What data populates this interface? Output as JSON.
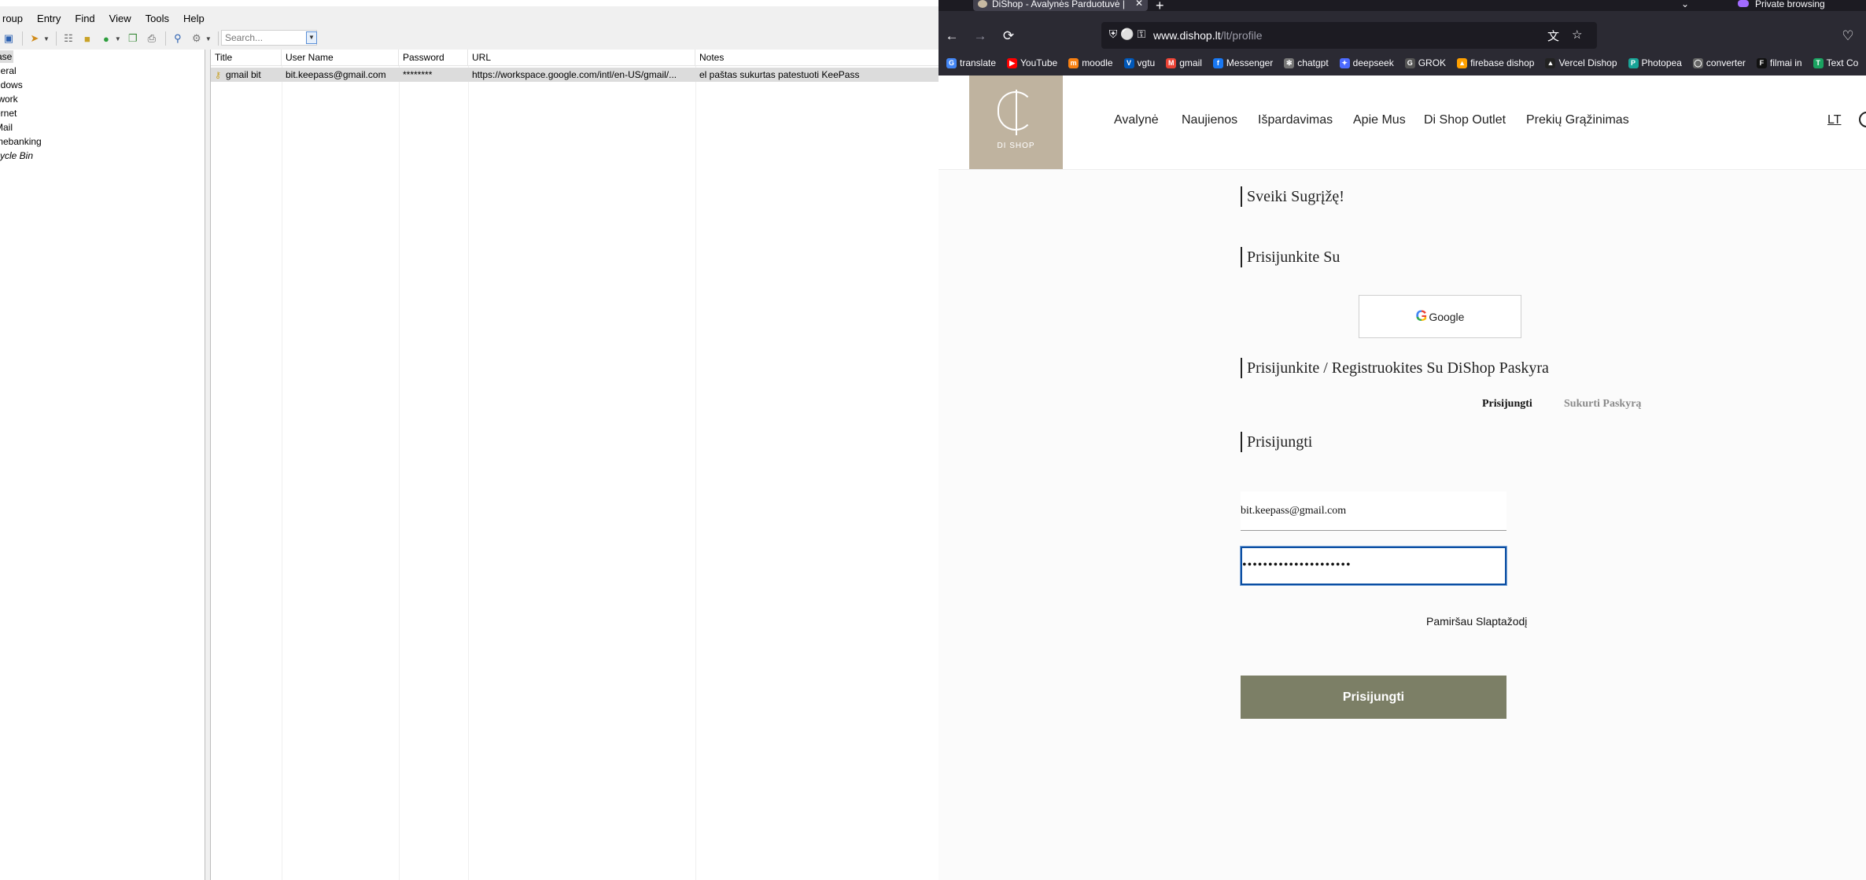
{
  "keepass": {
    "menu": [
      "roup",
      "Entry",
      "Find",
      "View",
      "Tools",
      "Help"
    ],
    "search_placeholder": "Search...",
    "groups": [
      {
        "label": "ase",
        "selected": true,
        "italic": false
      },
      {
        "label": "neral",
        "selected": false,
        "italic": false
      },
      {
        "label": "ndows",
        "selected": false,
        "italic": false
      },
      {
        "label": "twork",
        "selected": false,
        "italic": false
      },
      {
        "label": "ernet",
        "selected": false,
        "italic": false
      },
      {
        "label": "Mail",
        "selected": false,
        "italic": false
      },
      {
        "label": "mebanking",
        "selected": false,
        "italic": false
      },
      {
        "label": "cycle Bin",
        "selected": false,
        "italic": true
      }
    ],
    "columns": [
      "Title",
      "User Name",
      "Password",
      "URL",
      "Notes"
    ],
    "entries": [
      {
        "title": "gmail bit",
        "username": "bit.keepass@gmail.com",
        "password": "********",
        "url": "https://workspace.google.com/intl/en-US/gmail/...",
        "notes": "el paštas sukurtas patestuoti KeePass"
      }
    ],
    "icons": [
      "save-icon",
      "add-entry-icon",
      "key-icon",
      "lock-icon",
      "search-icon",
      "copy-icon",
      "print-icon"
    ]
  },
  "browser": {
    "tab_title": "DiShop - Avalynės Parduotuvė |",
    "private_label": "Private browsing",
    "url_host": "www.dishop.lt",
    "url_path": "/lt/profile",
    "bookmarks": [
      {
        "label": "translate",
        "color": "#4285f4"
      },
      {
        "label": "YouTube",
        "color": "#ff0000"
      },
      {
        "label": "moodle",
        "color": "#f98012"
      },
      {
        "label": "vgtu",
        "color": "#0057b8"
      },
      {
        "label": "gmail",
        "color": "#ea4335"
      },
      {
        "label": "Messenger",
        "color": "#1877f2"
      },
      {
        "label": "chatgpt",
        "color": "#777777"
      },
      {
        "label": "deepseek",
        "color": "#4d6bfe"
      },
      {
        "label": "GROK",
        "color": "#555555"
      },
      {
        "label": "firebase dishop",
        "color": "#ffa000"
      },
      {
        "label": "Vercel Dishop",
        "color": "#222222"
      },
      {
        "label": "Photopea",
        "color": "#18a497"
      },
      {
        "label": "converter",
        "color": "#666666"
      },
      {
        "label": "filmai in",
        "color": "#111111"
      },
      {
        "label": "Text Co",
        "color": "#1aa260"
      }
    ]
  },
  "site": {
    "logo_text": "DI SHOP",
    "nav": [
      "Avalynė",
      "Naujienos",
      "Išpardavimas",
      "Apie Mus",
      "Di Shop Outlet",
      "Prekių Grąžinimas"
    ],
    "lang": "LT",
    "welcome": "Sveiki Sugrįžę!",
    "login_with": "Prisijunkite Su",
    "google_label": "Google",
    "register_title": "Prisijunkite / Registruokites Su DiShop Paskyra",
    "tab_login": "Prisijungti",
    "tab_create": "Sukurti Paskyrą",
    "login_title": "Prisijungti",
    "email_value": "bit.keepass@gmail.com",
    "password_value": "•••••••••••••••••••••",
    "forgot": "Pamiršau Slaptažodį",
    "submit": "Prisijungti"
  }
}
